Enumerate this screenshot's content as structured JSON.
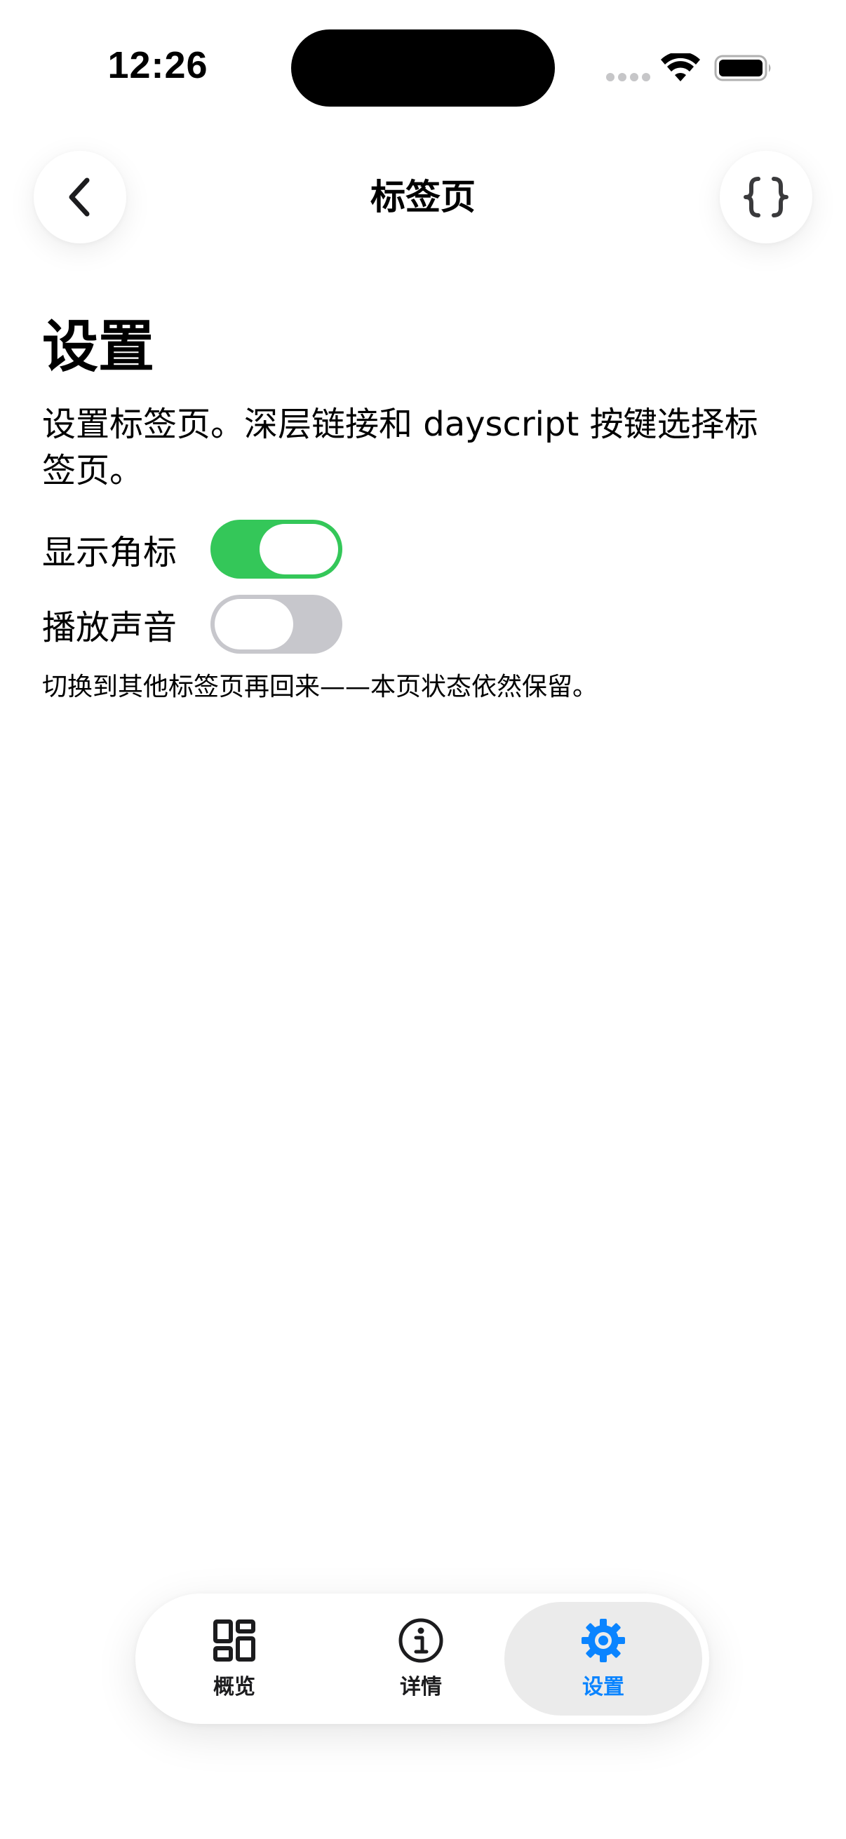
{
  "status_bar": {
    "time": "12:26"
  },
  "nav": {
    "title": "标签页",
    "back_icon": "chevron-left-icon",
    "code_icon": "curly-braces-icon"
  },
  "content": {
    "heading": "设置",
    "description": "设置标签页。深层链接和 dayscript 按键选择标签页。",
    "toggles": [
      {
        "label": "显示角标",
        "on": true
      },
      {
        "label": "播放声音",
        "on": false
      }
    ],
    "footnote": "切换到其他标签页再回来——本页状态依然保留。"
  },
  "tab_bar": {
    "items": [
      {
        "label": "概览",
        "icon": "grid-icon",
        "active": false
      },
      {
        "label": "详情",
        "icon": "info-icon",
        "active": false
      },
      {
        "label": "设置",
        "icon": "gear-icon",
        "active": true
      }
    ]
  },
  "colors": {
    "accent": "#0a84ff",
    "toggle_on": "#34c759",
    "toggle_off": "#c7c7cc"
  }
}
